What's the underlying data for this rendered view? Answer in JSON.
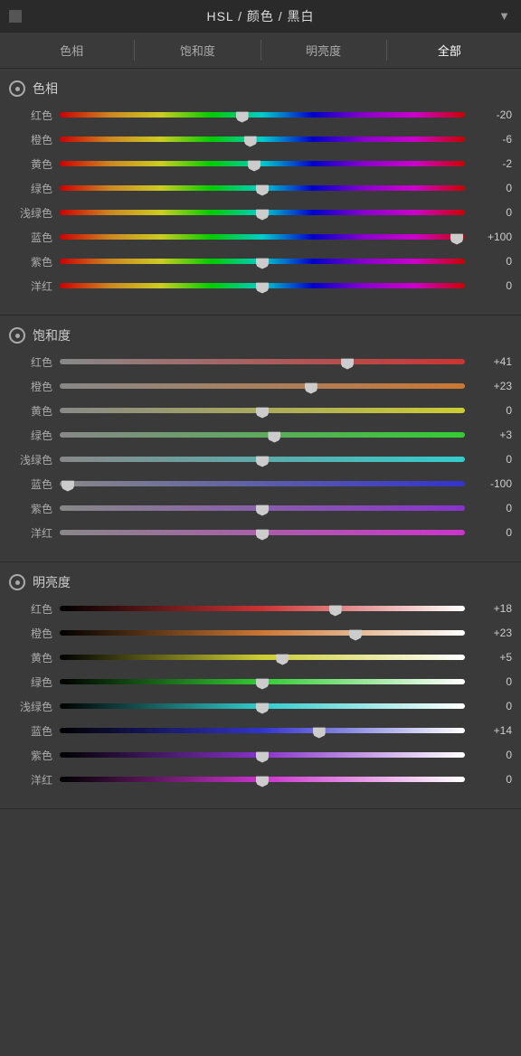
{
  "titleBar": {
    "title": "HSL / 颜色 / 黑白",
    "dropdownSymbol": "▼"
  },
  "tabs": [
    {
      "label": "色相",
      "active": false
    },
    {
      "label": "饱和度",
      "active": false
    },
    {
      "label": "明亮度",
      "active": false
    },
    {
      "label": "全部",
      "active": true
    }
  ],
  "sections": [
    {
      "id": "hue",
      "title": "色相",
      "rows": [
        {
          "label": "红色",
          "value": "-20",
          "thumbPct": 45,
          "gradientClass": "hue-red"
        },
        {
          "label": "橙色",
          "value": "-6",
          "thumbPct": 47,
          "gradientClass": "hue-orange"
        },
        {
          "label": "黄色",
          "value": "-2",
          "thumbPct": 48,
          "gradientClass": "hue-yellow"
        },
        {
          "label": "绿色",
          "value": "0",
          "thumbPct": 50,
          "gradientClass": "hue-green"
        },
        {
          "label": "浅绿色",
          "value": "0",
          "thumbPct": 50,
          "gradientClass": "hue-aqua"
        },
        {
          "label": "蓝色",
          "value": "+100",
          "thumbPct": 98,
          "gradientClass": "hue-blue"
        },
        {
          "label": "紫色",
          "value": "0",
          "thumbPct": 50,
          "gradientClass": "hue-purple"
        },
        {
          "label": "洋红",
          "value": "0",
          "thumbPct": 50,
          "gradientClass": "hue-magenta"
        }
      ]
    },
    {
      "id": "saturation",
      "title": "饱和度",
      "rows": [
        {
          "label": "红色",
          "value": "+41",
          "thumbPct": 71,
          "gradientClass": "sat-red"
        },
        {
          "label": "橙色",
          "value": "+23",
          "thumbPct": 62,
          "gradientClass": "sat-orange"
        },
        {
          "label": "黄色",
          "value": "0",
          "thumbPct": 50,
          "gradientClass": "sat-yellow"
        },
        {
          "label": "绿色",
          "value": "+3",
          "thumbPct": 53,
          "gradientClass": "sat-green"
        },
        {
          "label": "浅绿色",
          "value": "0",
          "thumbPct": 50,
          "gradientClass": "sat-aqua"
        },
        {
          "label": "蓝色",
          "value": "-100",
          "thumbPct": 2,
          "gradientClass": "sat-blue"
        },
        {
          "label": "紫色",
          "value": "0",
          "thumbPct": 50,
          "gradientClass": "sat-purple"
        },
        {
          "label": "洋红",
          "value": "0",
          "thumbPct": 50,
          "gradientClass": "sat-magenta"
        }
      ]
    },
    {
      "id": "luminance",
      "title": "明亮度",
      "rows": [
        {
          "label": "红色",
          "value": "+18",
          "thumbPct": 68,
          "gradientClass": "lum-red"
        },
        {
          "label": "橙色",
          "value": "+23",
          "thumbPct": 73,
          "gradientClass": "lum-orange"
        },
        {
          "label": "黄色",
          "value": "+5",
          "thumbPct": 55,
          "gradientClass": "lum-yellow"
        },
        {
          "label": "绿色",
          "value": "0",
          "thumbPct": 50,
          "gradientClass": "lum-green"
        },
        {
          "label": "浅绿色",
          "value": "0",
          "thumbPct": 50,
          "gradientClass": "lum-aqua"
        },
        {
          "label": "蓝色",
          "value": "+14",
          "thumbPct": 64,
          "gradientClass": "lum-blue"
        },
        {
          "label": "紫色",
          "value": "0",
          "thumbPct": 50,
          "gradientClass": "lum-purple"
        },
        {
          "label": "洋红",
          "value": "0",
          "thumbPct": 50,
          "gradientClass": "lum-magenta"
        }
      ]
    }
  ]
}
